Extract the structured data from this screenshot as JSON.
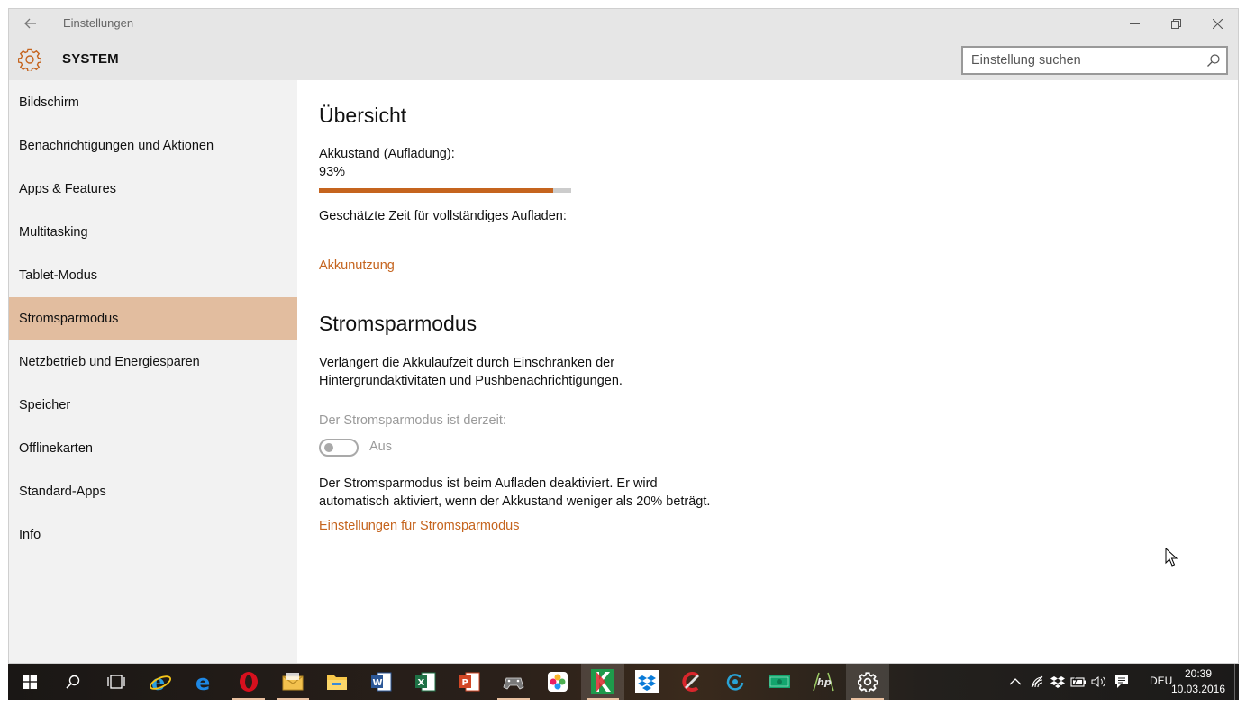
{
  "window": {
    "title": "Einstellungen",
    "section": "SYSTEM"
  },
  "search": {
    "placeholder": "Einstellung suchen"
  },
  "colors": {
    "accent": "#c5641e",
    "active_nav": "#e2bd9f",
    "sidebar_bg": "#f2f2f2",
    "header_bg": "#e6e6e6"
  },
  "sidebar": {
    "items": [
      {
        "label": "Bildschirm"
      },
      {
        "label": "Benachrichtigungen und Aktionen"
      },
      {
        "label": "Apps & Features"
      },
      {
        "label": "Multitasking"
      },
      {
        "label": "Tablet-Modus"
      },
      {
        "label": "Stromsparmodus",
        "active": true
      },
      {
        "label": "Netzbetrieb und Energiesparen"
      },
      {
        "label": "Speicher"
      },
      {
        "label": "Offlinekarten"
      },
      {
        "label": "Standard-Apps"
      },
      {
        "label": "Info"
      }
    ]
  },
  "overview": {
    "heading": "Übersicht",
    "battery_label": "Akkustand (Aufladung):",
    "battery_value": "93%",
    "battery_fraction": 0.93,
    "estimate_label": "Geschätzte Zeit für vollständiges Aufladen:",
    "usage_link": "Akkunutzung"
  },
  "saver": {
    "heading": "Stromsparmodus",
    "description_line1": "Verlängert die Akkulaufzeit durch Einschränken der",
    "description_line2": "Hintergrundaktivitäten und Pushbenachrichtigungen.",
    "state_label": "Der Stromsparmodus ist derzeit:",
    "toggle_state": "Aus",
    "note_line1": "Der Stromsparmodus ist beim Aufladen deaktiviert. Er wird",
    "note_line2": "automatisch aktiviert, wenn der Akkustand weniger als 20% beträgt.",
    "settings_link": "Einstellungen für Stromsparmodus"
  },
  "taskbar": {
    "apps": [
      "start-icon",
      "search-icon",
      "task-view-icon",
      "internet-explorer-icon",
      "edge-icon",
      "opera-icon",
      "mail-icon",
      "file-explorer-icon",
      "word-icon",
      "excel-icon",
      "powerpoint-icon",
      "xbox-icon",
      "photos-icon",
      "kaspersky-icon",
      "dropbox-icon",
      "ccleaner-icon",
      "app-ring-icon",
      "money-icon",
      "hp-icon",
      "settings-icon"
    ],
    "language": "DEU",
    "time": "20:39",
    "date": "10.03.2016"
  }
}
